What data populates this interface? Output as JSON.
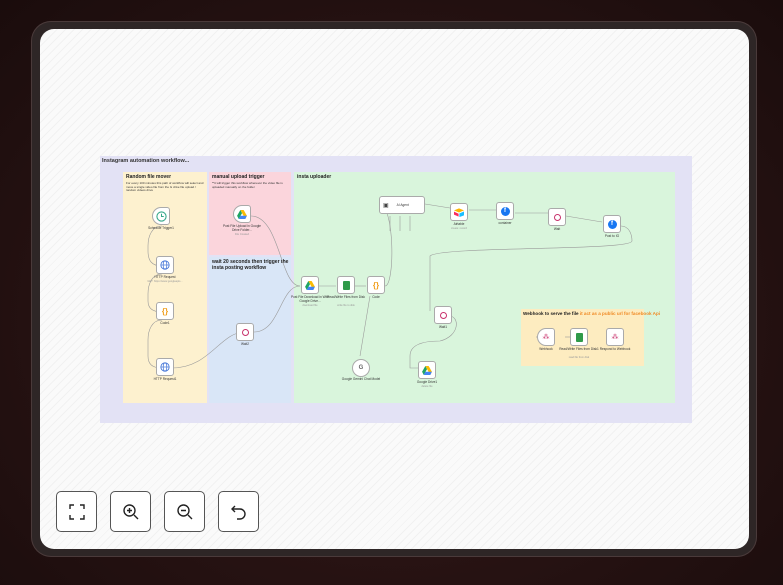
{
  "workflow": {
    "title": "Instagram automation workflow...",
    "stickies": {
      "random": {
        "title": "Random file mover",
        "desc": "For every 100 minutes this path of workflow will select and move a single video file from the G drive file upload / random videos drive"
      },
      "manual": {
        "title": "manual upload trigger",
        "desc": "**it will trigger this workflow whenever the video file is uploaded manually on the folder"
      },
      "wait20": {
        "title": "wait 20 seconds then trigger the insta posting workflow"
      },
      "insta": {
        "title": "insta uploader"
      },
      "webhook": {
        "title": "Webhook to serve the file",
        "title_highlight": "it act as a public url for facebook Api"
      }
    },
    "nodes": {
      "schedule": {
        "label": "Schedule Trigger1"
      },
      "http1": {
        "label": "HTTP Request",
        "sub": "GET: https://www.googleapis..."
      },
      "code1": {
        "label": "Code1"
      },
      "http2": {
        "label": "HTTP Request1"
      },
      "upload": {
        "label": "Post File Upload in Google Drive Folder...",
        "sub": "File Created"
      },
      "wait2": {
        "label": "Wait2"
      },
      "gdl": {
        "label": "Post File Download in With Google Drive...",
        "sub": "download file"
      },
      "readwrite": {
        "label": "Read/Write Files from Disk",
        "sub": "write file to disk"
      },
      "code": {
        "label": "Code"
      },
      "agent": {
        "label": "AI Agent"
      },
      "airtable": {
        "label": "Airtable",
        "sub": "create: record"
      },
      "container": {
        "label": "container"
      },
      "wait": {
        "label": "Wait"
      },
      "postig": {
        "label": "Post to IG"
      },
      "wait1": {
        "label": "Wait1"
      },
      "gemini": {
        "label": "Google Gemini Chat Model"
      },
      "gdrive": {
        "label": "Google Drive1",
        "sub": "delete file"
      },
      "webhook": {
        "label": "Webhook"
      },
      "readwrite2": {
        "label": "Read/Write Files from Disk1",
        "sub": "read file from disk"
      },
      "respond": {
        "label": "Respond to Webhook"
      }
    }
  },
  "controls": {
    "fit": "fit-view-icon",
    "zoom_in": "zoom-in-icon",
    "zoom_out": "zoom-out-icon",
    "reset": "undo-icon"
  },
  "colors": {
    "random": "#fdf1cf",
    "manual": "#fbd5dc",
    "wait20": "#d9e6f7",
    "insta": "#d9f5dc",
    "webhook": "#fdecc0",
    "accent_orange": "#f08a24"
  }
}
